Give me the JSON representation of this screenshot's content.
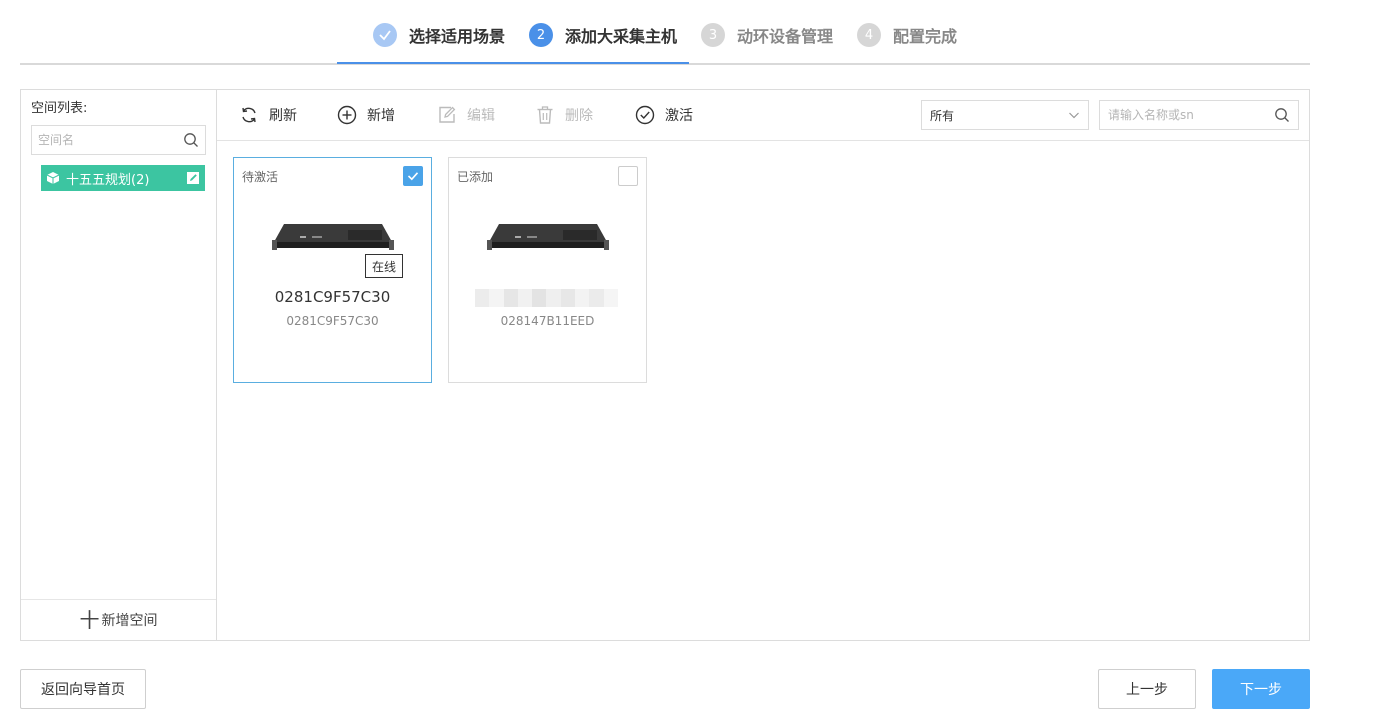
{
  "steps": [
    {
      "num": "✓",
      "label": "选择适用场景",
      "state": "done"
    },
    {
      "num": "2",
      "label": "添加大采集主机",
      "state": "active"
    },
    {
      "num": "3",
      "label": "动环设备管理",
      "state": "todo"
    },
    {
      "num": "4",
      "label": "配置完成",
      "state": "todo"
    }
  ],
  "sidebar": {
    "title": "空间列表:",
    "search_placeholder": "空间名",
    "items": [
      {
        "label": "十五五规划(2)"
      }
    ],
    "add_label": "新增空间",
    "add_symbol": "十"
  },
  "toolbar": {
    "refresh": "刷新",
    "add": "新增",
    "edit": "编辑",
    "delete": "删除",
    "activate": "激活",
    "filter_value": "所有",
    "search_placeholder": "请输入名称或sn"
  },
  "cards": [
    {
      "status": "待激活",
      "checked": true,
      "badge": "在线",
      "name": "0281C9F57C30",
      "sn": "0281C9F57C30"
    },
    {
      "status": "已添加",
      "checked": false,
      "name": "",
      "sn": "028147B11EED"
    }
  ],
  "footer": {
    "back_home": "返回向导首页",
    "prev": "上一步",
    "next": "下一步"
  },
  "colors": {
    "accent": "#4a90e8",
    "space_item": "#3cc5a1",
    "primary_button": "#4aa8f8"
  }
}
